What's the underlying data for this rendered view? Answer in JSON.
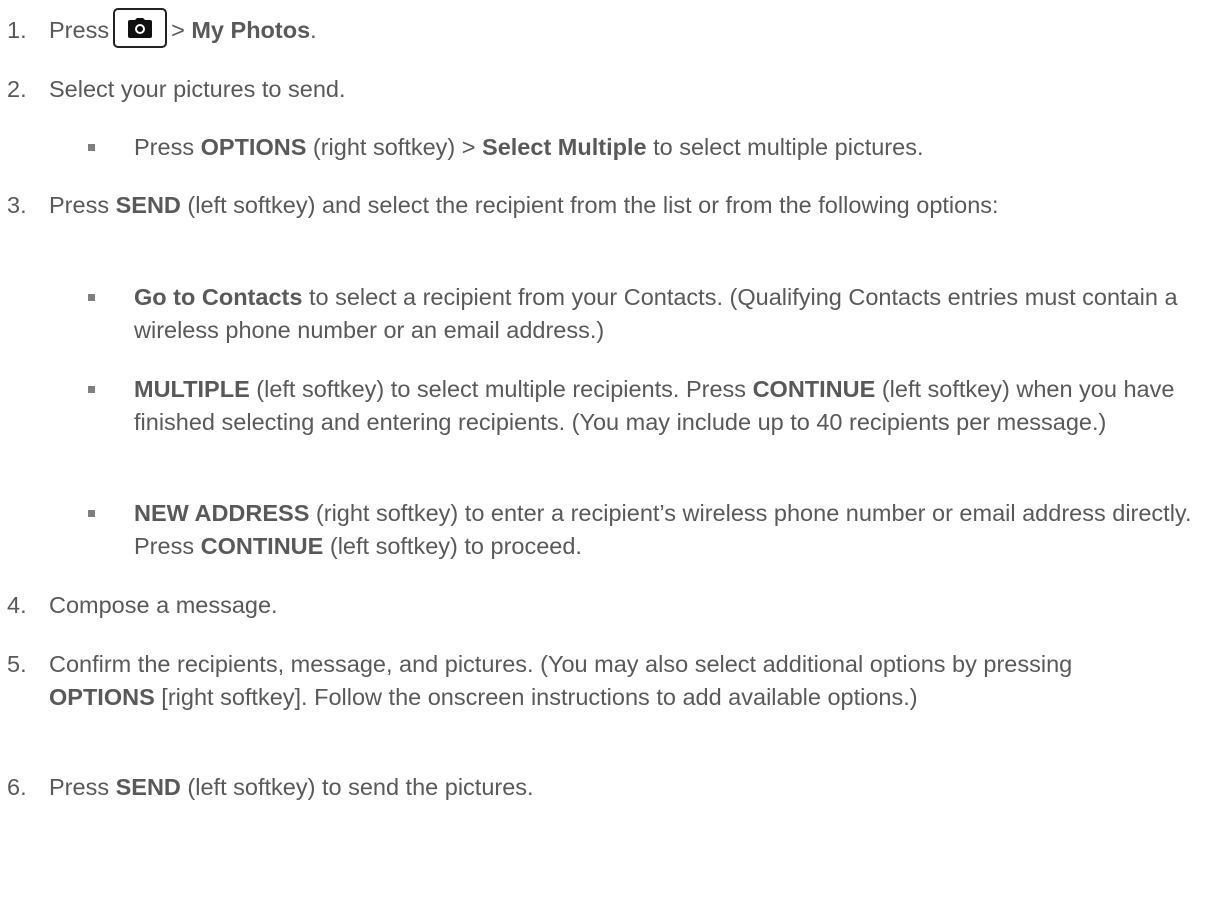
{
  "icons": {
    "camera_key": "camera-icon"
  },
  "steps": [
    {
      "num": "1.",
      "parts": [
        "Press",
        "> ",
        "My Photos",
        "."
      ]
    },
    {
      "num": "2.",
      "text": "Select your pictures to send."
    },
    {
      "num": "3.",
      "parts": [
        "Press ",
        "SEND",
        " (left softkey) and select the recipient from the list or from the following options:"
      ]
    },
    {
      "num": "4.",
      "text": "Compose a message."
    },
    {
      "num": "5.",
      "parts": [
        "Confirm the recipients, message, and pictures. (You may also select additional options by pressing ",
        "OPTIONS",
        " [right softkey]. Follow the onscreen instructions to add available options.)"
      ]
    },
    {
      "num": "6.",
      "parts": [
        "Press ",
        "SEND",
        " (left softkey) to send the pictures."
      ]
    }
  ],
  "substeps": {
    "step2": [
      {
        "parts": [
          "Press ",
          "OPTIONS",
          " (right softkey) > ",
          "Select Multiple",
          " to select multiple pictures."
        ]
      }
    ],
    "step3": [
      {
        "parts": [
          "Go to Contacts",
          " to select a recipient from your Contacts. (Qualifying Contacts entries must contain a wireless phone number or an email address.)"
        ]
      },
      {
        "parts": [
          "MULTIPLE",
          " (left softkey) to select multiple recipients. Press ",
          "CONTINUE",
          " (left softkey) when you have finished selecting and entering recipients. (You may include up to 40 recipients per message.)"
        ]
      },
      {
        "parts": [
          "NEW ADDRESS",
          " (right softkey) to enter a recipient’s wireless phone number or email address directly. Press ",
          "CONTINUE",
          " (left softkey) to proceed."
        ]
      }
    ]
  }
}
